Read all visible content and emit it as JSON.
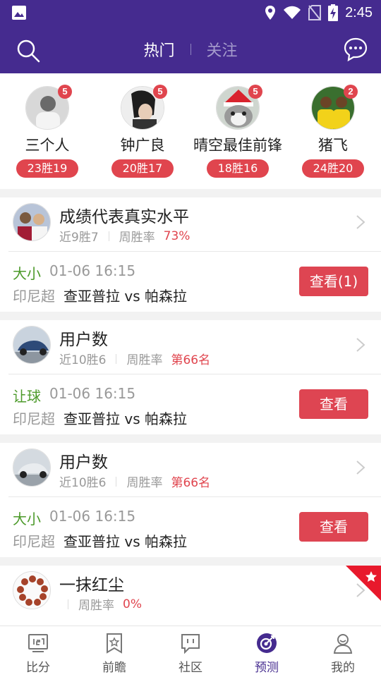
{
  "status_bar": {
    "time": "2:45"
  },
  "header": {
    "tabs": [
      {
        "label": "热门",
        "active": true
      },
      {
        "label": "关注",
        "active": false
      }
    ]
  },
  "experts": [
    {
      "name": "三个人",
      "badge": "5",
      "record": "23胜19"
    },
    {
      "name": "钟广良",
      "badge": "5",
      "record": "20胜17"
    },
    {
      "name": "晴空最佳前锋",
      "badge": "5",
      "record": "18胜16"
    },
    {
      "name": "猪飞",
      "badge": "2",
      "record": "24胜20"
    }
  ],
  "cards": [
    {
      "user": {
        "name": "成绩代表真实水平",
        "recent": "近9胜7",
        "rate_label": "周胜率",
        "rate_value": "73%"
      },
      "match": {
        "type": "大小",
        "time": "01-06 16:15",
        "league": "印尼超",
        "teams": "查亚普拉 vs 帕森拉",
        "button": "查看(1)"
      }
    },
    {
      "user": {
        "name": "用户数",
        "recent": "近10胜6",
        "rate_label": "周胜率",
        "rate_value": "第66名"
      },
      "match": {
        "type": "让球",
        "time": "01-06 16:15",
        "league": "印尼超",
        "teams": "查亚普拉 vs 帕森拉",
        "button": "查看"
      }
    },
    {
      "user": {
        "name": "用户数",
        "recent": "近10胜6",
        "rate_label": "周胜率",
        "rate_value": "第66名"
      },
      "match": {
        "type": "大小",
        "time": "01-06 16:15",
        "league": "印尼超",
        "teams": "查亚普拉 vs 帕森拉",
        "button": "查看"
      }
    },
    {
      "user": {
        "name": "一抹红尘",
        "recent": "",
        "rate_label": "周胜率",
        "rate_value": "0%"
      }
    }
  ],
  "bottom_nav": [
    {
      "label": "比分",
      "icon": "scoreboard-icon",
      "active": false
    },
    {
      "label": "前瞻",
      "icon": "bookmark-star-icon",
      "active": false
    },
    {
      "label": "社区",
      "icon": "chat-bubble-icon",
      "active": false
    },
    {
      "label": "预测",
      "icon": "target-icon",
      "active": true
    },
    {
      "label": "我的",
      "icon": "user-icon",
      "active": false
    }
  ],
  "colors": {
    "brand": "#452b8f",
    "accent": "#de4552",
    "win_green": "#4c9a2a"
  }
}
